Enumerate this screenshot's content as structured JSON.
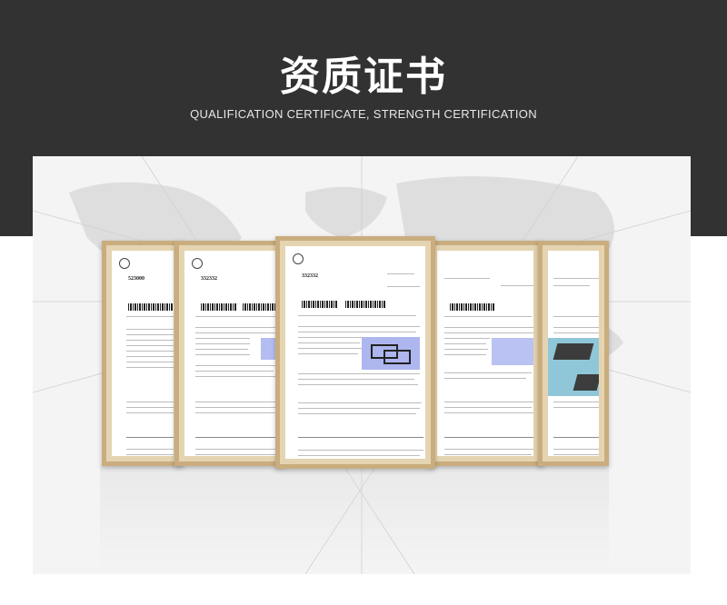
{
  "header": {
    "title": "资质证书",
    "subtitle": "QUALIFICATION CERTIFICATE, STRENGTH CERTIFICATION"
  },
  "certificates": [
    {
      "number": "523000"
    },
    {
      "number": "332332"
    },
    {
      "number": "332332"
    },
    {
      "number": ""
    },
    {
      "number": ""
    }
  ]
}
